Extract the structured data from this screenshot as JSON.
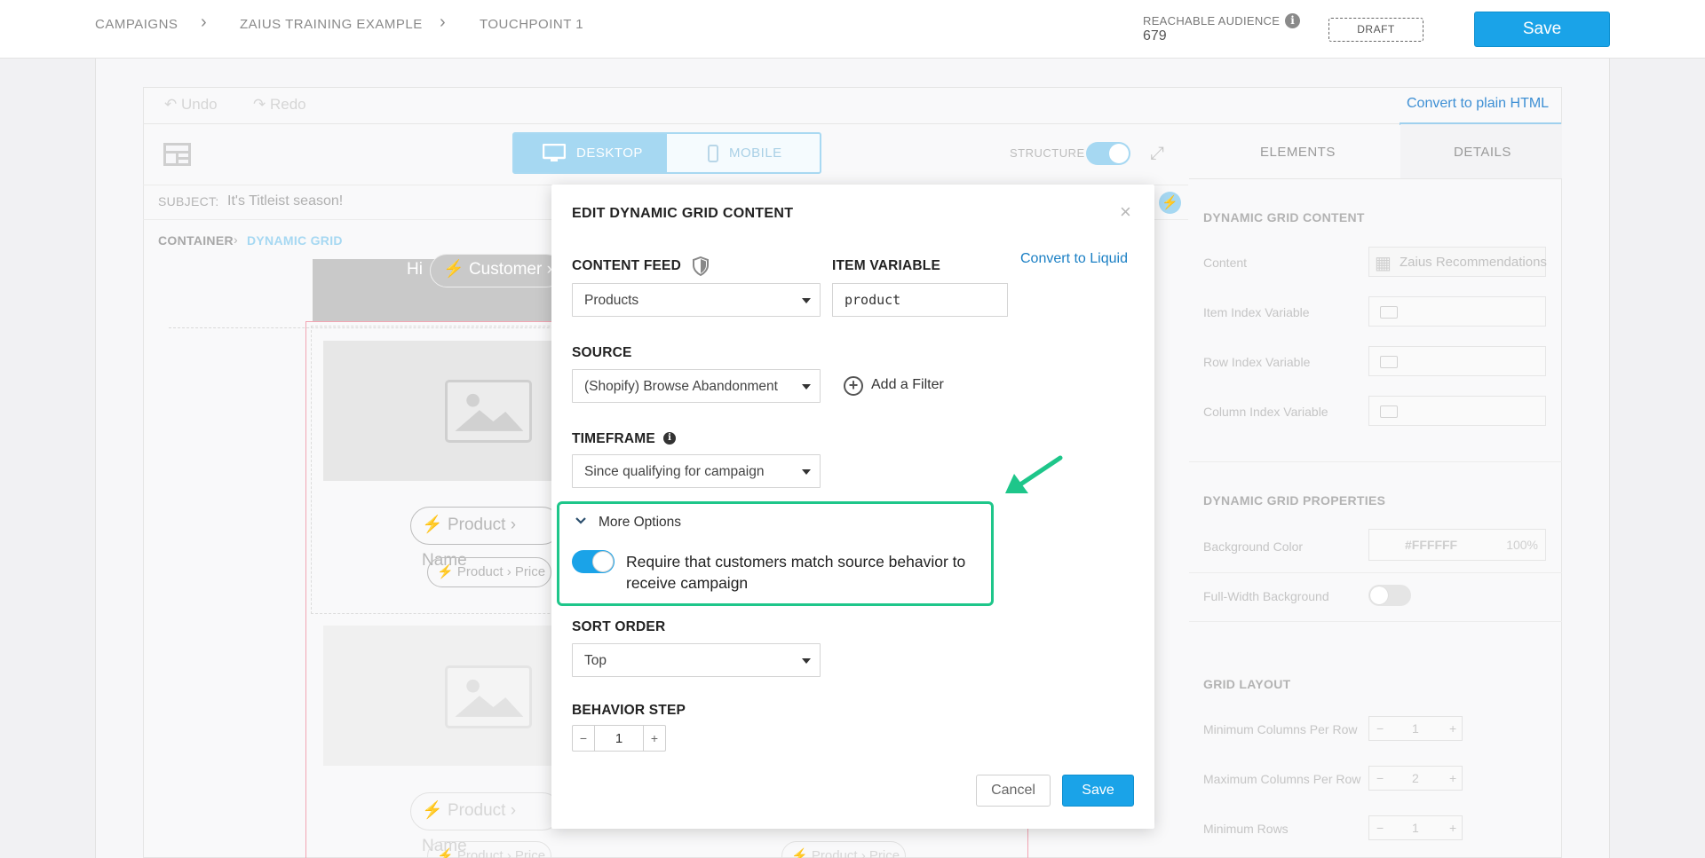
{
  "breadcrumb": [
    {
      "label": "CAMPAIGNS"
    },
    {
      "label": "ZAIUS TRAINING EXAMPLE"
    },
    {
      "label": "TOUCHPOINT 1"
    }
  ],
  "audience": {
    "label": "REACHABLE AUDIENCE",
    "value": "679"
  },
  "status_badge": "DRAFT",
  "top_save": "Save",
  "editor": {
    "undo": "Undo",
    "redo": "Redo",
    "convert_html": "Convert to plain HTML",
    "device_desktop": "DESKTOP",
    "device_mobile": "MOBILE",
    "structure_label": "STRUCTURE",
    "subject_label": "SUBJECT:",
    "subject_value": "It's Titleist season!",
    "path_container": "CONTAINER",
    "path_sep": "›",
    "path_grid": "DYNAMIC GRID",
    "canvas_hi": "Hi",
    "pill_customer": "Customer ›",
    "pill_name": "Product › Name",
    "pill_price": "Product › Price"
  },
  "right_panel": {
    "tab_elements": "ELEMENTS",
    "tab_details": "DETAILS",
    "section_content": "DYNAMIC GRID CONTENT",
    "content_label": "Content",
    "content_value": "Zaius Recommendations",
    "item_index_label": "Item Index Variable",
    "row_index_label": "Row Index Variable",
    "column_index_label": "Column Index Variable",
    "section_properties": "DYNAMIC GRID PROPERTIES",
    "bg_color_label": "Background Color",
    "bg_color_value": "#FFFFFF",
    "bg_color_opacity": "100%",
    "full_width_label": "Full-Width Background",
    "section_layout": "GRID LAYOUT",
    "min_cols_label": "Minimum Columns Per Row",
    "min_cols_value": "1",
    "max_cols_label": "Maximum Columns Per Row",
    "max_cols_value": "2",
    "min_rows_label": "Minimum Rows",
    "min_rows_value": "1"
  },
  "modal": {
    "title": "EDIT DYNAMIC GRID CONTENT",
    "close": "×",
    "content_feed_label": "CONTENT FEED",
    "content_feed_value": "Products",
    "item_variable_label": "ITEM VARIABLE",
    "item_variable_value": "product",
    "convert_liquid": "Convert to Liquid",
    "source_label": "SOURCE",
    "source_value": "(Shopify) Browse Abandonment",
    "add_filter": "Add a Filter",
    "timeframe_label": "TIMEFRAME",
    "timeframe_value": "Since qualifying for campaign",
    "more_options": "More Options",
    "require_toggle_on": true,
    "require_text": "Require that customers match source behavior to receive campaign",
    "sort_order_label": "SORT ORDER",
    "sort_order_value": "Top",
    "behavior_step_label": "BEHAVIOR STEP",
    "behavior_step_value": "1",
    "cancel": "Cancel",
    "save": "Save"
  },
  "colors": {
    "accent": "#1aa3e8",
    "highlight": "#1ec68a",
    "link": "#1a7fc4"
  }
}
